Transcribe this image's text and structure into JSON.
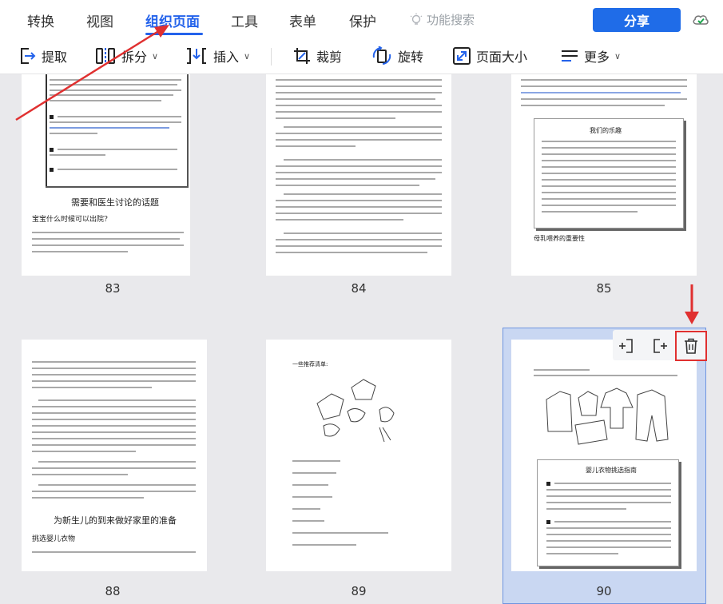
{
  "menu": {
    "tabs": [
      {
        "label": "转换"
      },
      {
        "label": "视图"
      },
      {
        "label": "组织页面"
      },
      {
        "label": "工具"
      },
      {
        "label": "表单"
      },
      {
        "label": "保护"
      }
    ],
    "active_tab": "组织页面",
    "feature_search_label": "功能搜索",
    "share_label": "分享"
  },
  "toolbar": {
    "extract": "提取",
    "split": "拆分",
    "insert": "插入",
    "crop": "裁剪",
    "rotate": "旋转",
    "page_size": "页面大小",
    "more": "更多"
  },
  "pages": [
    {
      "number": "83",
      "heading": "需要和医生讨论的话题",
      "subheading": "宝宝什么时候可以出院?"
    },
    {
      "number": "84"
    },
    {
      "number": "85",
      "box_title": "我们的乐趣",
      "footer_heading": "母乳喂养的重要性"
    },
    {
      "number": "88",
      "heading": "为新生儿的到来做好家里的准备",
      "subheading": "挑选婴儿衣物"
    },
    {
      "number": "89",
      "heading": "一些推荐清单:"
    },
    {
      "number": "90",
      "box_title": "婴儿衣物挑选指南"
    }
  ],
  "colors": {
    "accent": "#2463eb",
    "share_button": "#1f6ce8",
    "annotation_red": "#e03030",
    "selection": "#c9d7f2"
  }
}
